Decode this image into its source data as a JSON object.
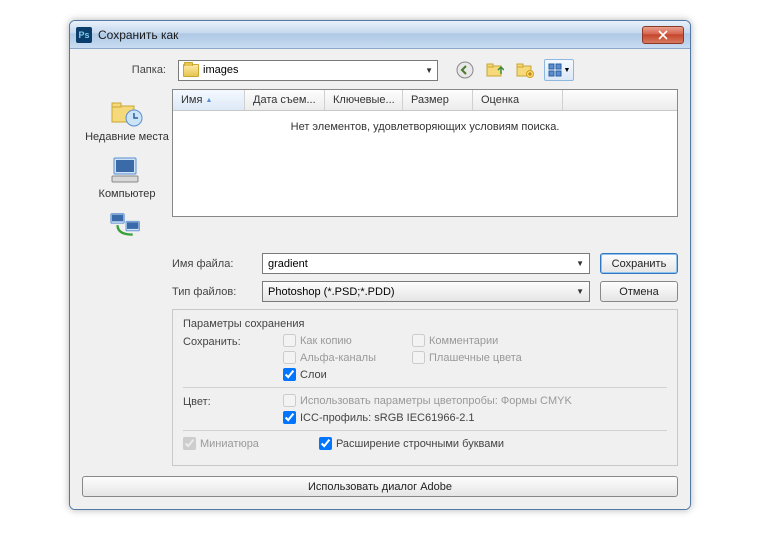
{
  "titlebar": {
    "title": "Сохранить как",
    "app_icon_text": "Ps"
  },
  "folder": {
    "label": "Папка:",
    "value": "images"
  },
  "columns": {
    "name": "Имя",
    "date": "Дата съем...",
    "keys": "Ключевые...",
    "size": "Размер",
    "rating": "Оценка"
  },
  "filelist_empty": "Нет элементов, удовлетворяющих условиям поиска.",
  "sidebar": {
    "recent": "Недавние места",
    "computer": "Компьютер"
  },
  "filename": {
    "label": "Имя файла:",
    "value": "gradient"
  },
  "filetype": {
    "label": "Тип файлов:",
    "value": "Photoshop (*.PSD;*.PDD)"
  },
  "buttons": {
    "save": "Сохранить",
    "cancel": "Отмена",
    "adobe": "Использовать диалог Adobe"
  },
  "params": {
    "heading": "Параметры сохранения",
    "save_label": "Сохранить:",
    "as_copy": "Как копию",
    "comments": "Комментарии",
    "alpha": "Альфа-каналы",
    "spot": "Плашечные цвета",
    "layers": "Слои",
    "color_label": "Цвет:",
    "use_proof": "Использовать параметры цветопробы:  Формы CMYK",
    "icc": "ICC-профиль:  sRGB IEC61966-2.1",
    "thumbnail": "Миниатюра",
    "lowercase_ext": "Расширение строчными буквами"
  }
}
